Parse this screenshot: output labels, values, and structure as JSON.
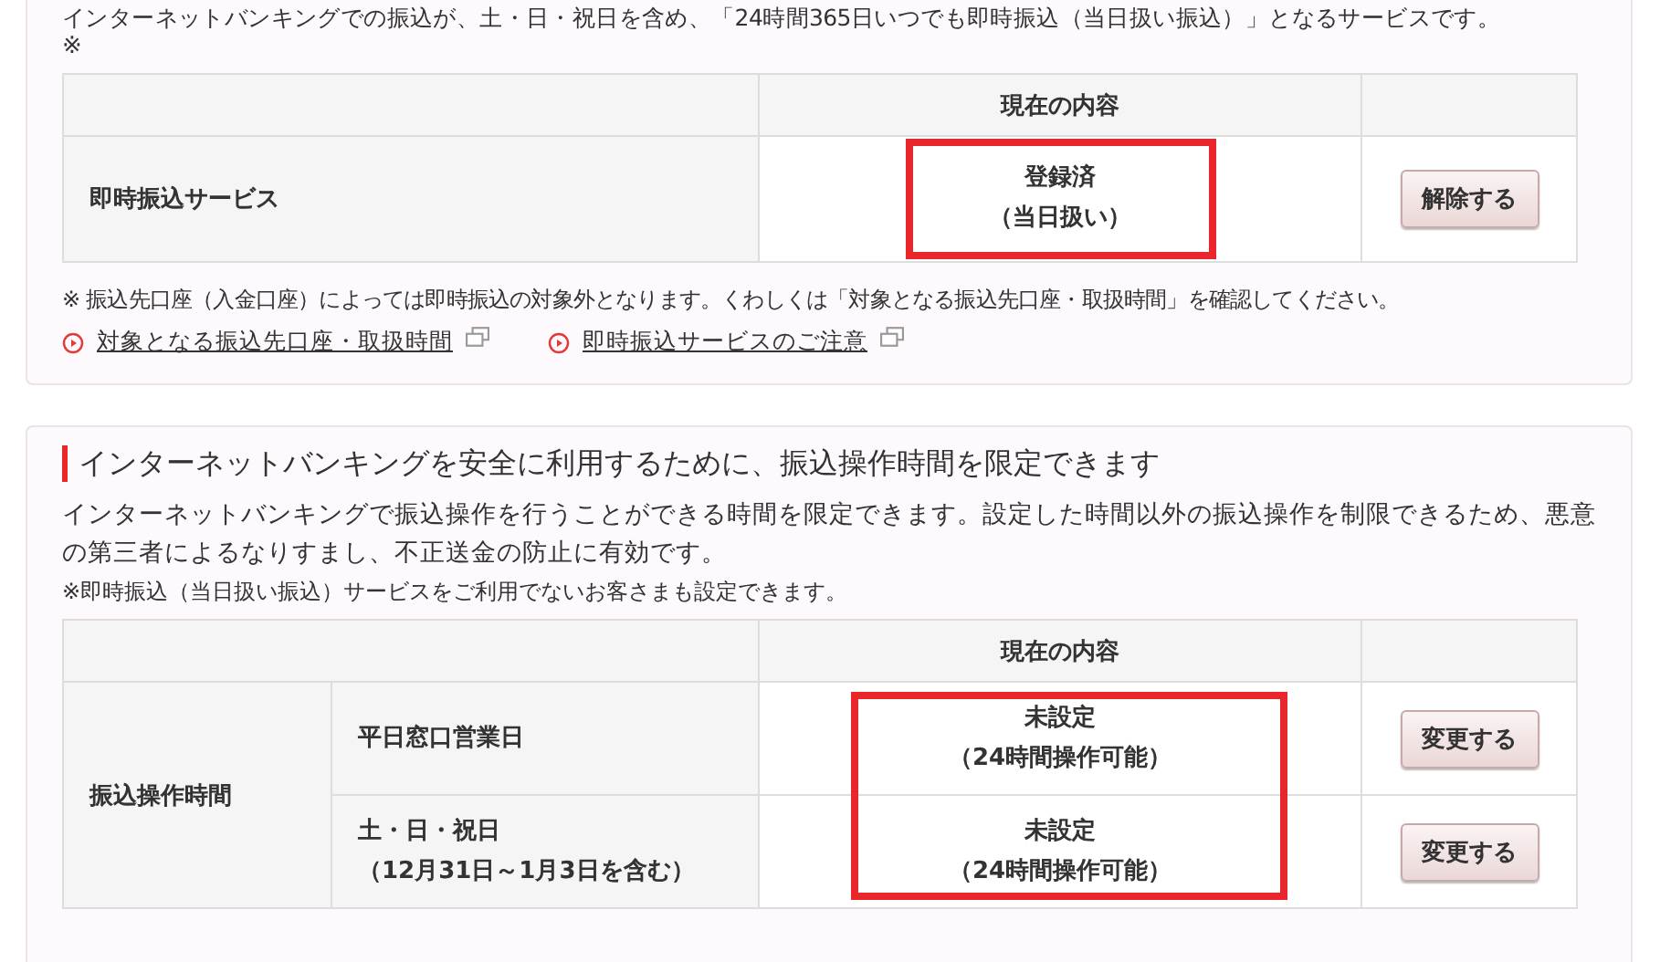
{
  "instant_panel": {
    "intro": "インターネットバンキングでの振込が、土・日・祝日を含め、「24時間365日いつでも即時振込（当日扱い振込）」となるサービスです。",
    "intro_mark": "※",
    "table": {
      "header": "現在の内容",
      "highlighted": true,
      "row": {
        "label": "即時振込サービス",
        "status": [
          "登録済",
          "（当日扱い）"
        ],
        "button": "解除する"
      }
    },
    "note": "※ 振込先口座（入金口座）によっては即時振込の対象外となります。くわしくは「対象となる振込先口座・取扱時間」を確認してください。",
    "links": [
      "対象となる振込先口座・取扱時間",
      "即時振込サービスのご注意"
    ]
  },
  "time_panel": {
    "heading": "インターネットバンキングを安全に利用するために、振込操作時間を限定できます",
    "description": "インターネットバンキングで振込操作を行うことができる時間を限定できます。設定した時間以外の振込操作を制限できるため、悪意の第三者によるなりすまし、不正送金の防止に有効です。",
    "note": "※即時振込（当日扱い振込）サービスをご利用でないお客さまも設定できます。",
    "table": {
      "header": "現在の内容",
      "highlighted": true,
      "group_label": "振込操作時間",
      "rows": [
        {
          "label": [
            "平日窓口営業日"
          ],
          "status": [
            "未設定",
            "（24時間操作可能）"
          ],
          "button": "変更する"
        },
        {
          "label": [
            "土・日・祝日",
            "（12月31日～1月3日を含む）"
          ],
          "status": [
            "未設定",
            "（24時間操作可能）"
          ],
          "button": "変更する"
        }
      ]
    }
  }
}
